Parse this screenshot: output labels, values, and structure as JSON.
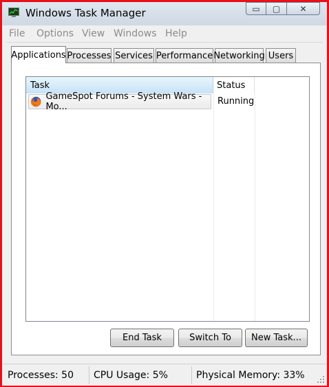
{
  "window": {
    "title": "Windows Task Manager"
  },
  "title_controls": {
    "minimize": "▭",
    "maximize": "▢",
    "close": "✕"
  },
  "menu": [
    "File",
    "Options",
    "View",
    "Windows",
    "Help"
  ],
  "tabs": [
    "Applications",
    "Processes",
    "Services",
    "Performance",
    "Networking",
    "Users"
  ],
  "active_tab": "Applications",
  "task_list": {
    "columns": {
      "task": "Task",
      "status": "Status"
    },
    "sort_indicator": "˄",
    "rows": [
      {
        "task": "GameSpot Forums - System Wars - Mo...",
        "status": "Running",
        "icon": "firefox-icon"
      }
    ]
  },
  "buttons": {
    "end_task": "End Task",
    "switch_to": "Switch To",
    "new_task": "New Task..."
  },
  "status_bar": {
    "processes": "Processes: 50",
    "cpu_usage": "CPU Usage: 5%",
    "physical_memory": "Physical Memory: 33%"
  },
  "colors": {
    "frame_border": "#e8101a",
    "title_bg": "#d7e1ea",
    "header_highlight": "#c6e3f7"
  }
}
